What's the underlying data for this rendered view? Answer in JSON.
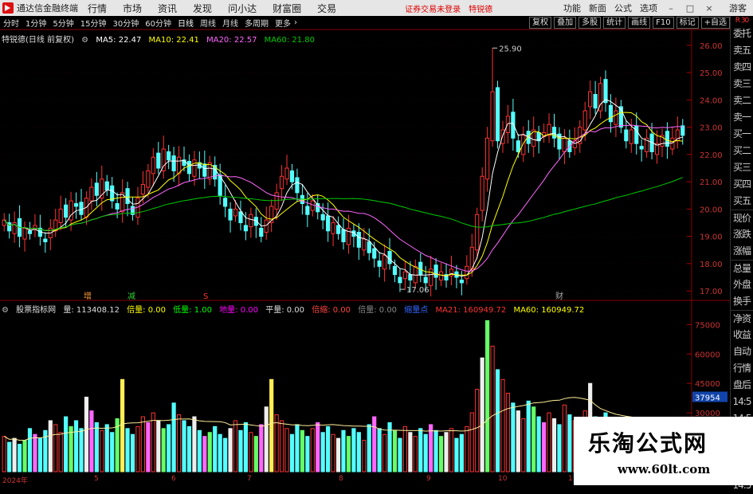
{
  "app": {
    "title": "通达信金融终端"
  },
  "menu": [
    "行情",
    "市场",
    "资讯",
    "发现",
    "问小达",
    "财富圈",
    "交易"
  ],
  "header_status": {
    "trading_status": "证券交易未登录",
    "stock_name": "特锐德"
  },
  "right_menu": [
    "功能",
    "新面",
    "公式",
    "选项"
  ],
  "guest_label": "游客",
  "periods": [
    "分时",
    "1分钟",
    "5分钟",
    "15分钟",
    "30分钟",
    "60分钟",
    "日线",
    "周线",
    "月线",
    "多周期",
    "更多"
  ],
  "active_period": "日线",
  "toolbar_right": [
    "复权",
    "叠加",
    "多股",
    "统计",
    "画线",
    "F10",
    "标记",
    "+自选"
  ],
  "main_legend": {
    "name": "特锐德(日线 前复权)",
    "ma5": "MA5: 22.47",
    "ma10": "MA10: 22.41",
    "ma20": "MA20: 22.57",
    "ma60": "MA60: 21.80"
  },
  "sub_legend": {
    "name": "股票指标网",
    "vol": "量: 113408.12",
    "bei": "倍量: 0.00",
    "di": "低量: 1.00",
    "diliang": "地量: 0.00",
    "ping": "平量: 0.00",
    "beisuo": "倍缩: 0.00",
    "bei2": "倍量: 0.00",
    "suoliang": "缩量点",
    "ma21": "MA21: 160949.72",
    "ma60": "MA60: 160949.72"
  },
  "side_panel": [
    "委托",
    "卖五",
    "卖四",
    "卖三",
    "卖二",
    "卖一",
    "买一",
    "买二",
    "买三",
    "买四",
    "买五",
    "现价",
    "涨跌",
    "涨幅",
    "总量",
    "外盘",
    "换手",
    "净资",
    "收益",
    "自动",
    "行情",
    "盘后",
    "14:5",
    "14:5",
    "14:5",
    "14:5",
    "14:5",
    "14:5"
  ],
  "side_r_label": "R\n30",
  "price_axis": [
    "26.00",
    "25.00",
    "24.00",
    "23.00",
    "22.00",
    "21.00",
    "20.00",
    "19.00",
    "18.00",
    "17.00"
  ],
  "vol_axis": [
    "75000",
    "60000",
    "45000",
    "30000"
  ],
  "vol_axis_highlight": "37954",
  "annotations": {
    "high": "25.90",
    "low": "17.06",
    "marker_jian": "减",
    "marker_cai": "财",
    "marker_zeng": "增",
    "marker_s": "S"
  },
  "bottom_axis": [
    "2024年",
    "5",
    "6",
    "7",
    "8",
    "9",
    "10",
    "1"
  ],
  "watermark": {
    "line1": "乐淘公式网",
    "line2": "www.60lt.com"
  },
  "colors": {
    "up": "#ff3333",
    "down": "#54ffff",
    "ma5": "#ffffff",
    "ma10": "#ffff00",
    "ma20": "#ff66ff",
    "ma60": "#00cc00"
  },
  "chart_data": {
    "type": "candlestick",
    "title": "特锐德(日线 前复权)",
    "ylim": [
      16.8,
      26.2
    ],
    "high_label": 25.9,
    "low_label": 17.06,
    "closes": [
      19.6,
      19.2,
      19.5,
      19.0,
      19.3,
      19.1,
      19.4,
      19.0,
      18.8,
      19.3,
      19.6,
      20.0,
      19.7,
      20.3,
      20.1,
      19.8,
      20.4,
      20.8,
      20.5,
      21.1,
      20.7,
      20.3,
      20.0,
      20.6,
      20.2,
      19.8,
      20.4,
      20.9,
      21.4,
      21.9,
      21.5,
      22.2,
      21.8,
      21.4,
      21.9,
      21.6,
      21.3,
      21.8,
      21.5,
      21.2,
      21.7,
      21.1,
      20.5,
      20.1,
      19.6,
      20.0,
      19.5,
      19.2,
      19.8,
      19.4,
      19.0,
      19.6,
      20.1,
      20.6,
      21.2,
      21.5,
      21.0,
      20.6,
      20.2,
      19.8,
      20.3,
      19.9,
      19.6,
      19.2,
      19.5,
      19.1,
      18.8,
      19.3,
      19.0,
      18.6,
      18.9,
      18.4,
      18.2,
      17.9,
      18.3,
      18.0,
      17.6,
      17.3,
      17.7,
      17.4,
      17.9,
      17.6,
      17.3,
      17.8,
      17.5,
      17.7,
      17.4,
      17.8,
      17.5,
      17.3,
      17.9,
      18.6,
      19.8,
      21.2,
      22.6,
      24.3,
      22.5,
      22.9,
      23.4,
      22.6,
      22.1,
      22.7,
      22.4,
      22.9,
      22.5,
      22.8,
      23.1,
      22.6,
      22.2,
      22.6,
      22.1,
      22.5,
      23.0,
      23.6,
      24.3,
      23.7,
      24.6,
      23.9,
      23.2,
      23.6,
      23.0,
      22.5,
      22.9,
      22.4,
      22.2,
      22.6,
      22.1,
      22.4,
      22.7,
      22.3,
      22.6,
      22.9,
      22.7
    ],
    "volumes": [
      18000,
      15000,
      17000,
      14000,
      16000,
      22000,
      19000,
      17000,
      21000,
      26000,
      24000,
      20000,
      28000,
      23000,
      26000,
      22000,
      38000,
      31000,
      25000,
      21000,
      24000,
      20000,
      27000,
      47000,
      22000,
      19000,
      23000,
      28000,
      25000,
      30000,
      26000,
      22000,
      24000,
      35000,
      29000,
      26000,
      23000,
      28000,
      21000,
      18000,
      20000,
      23000,
      19000,
      17000,
      22000,
      26000,
      21000,
      25000,
      20000,
      18000,
      24000,
      33000,
      47000,
      29000,
      26000,
      22000,
      19000,
      24000,
      21000,
      18000,
      22000,
      25000,
      20000,
      23000,
      19000,
      17000,
      21000,
      18000,
      22000,
      20000,
      16000,
      24000,
      28000,
      22000,
      19000,
      25000,
      21000,
      17000,
      23000,
      20000,
      18000,
      22000,
      19000,
      24000,
      21000,
      18000,
      20000,
      22000,
      17000,
      19000,
      23000,
      30000,
      42000,
      58000,
      77000,
      64000,
      52000,
      47000,
      40000,
      35000,
      31000,
      27000,
      36000,
      33000,
      28000,
      25000,
      30000,
      27000,
      24000,
      34000,
      29000,
      26000,
      23000,
      31000,
      45000,
      28000,
      25000,
      30000,
      26000,
      22000,
      24000,
      21000,
      19000,
      23000,
      20000,
      22000,
      18000,
      21000,
      19000,
      20000,
      22000,
      19000
    ],
    "vol_ylim": [
      0,
      80000
    ]
  }
}
